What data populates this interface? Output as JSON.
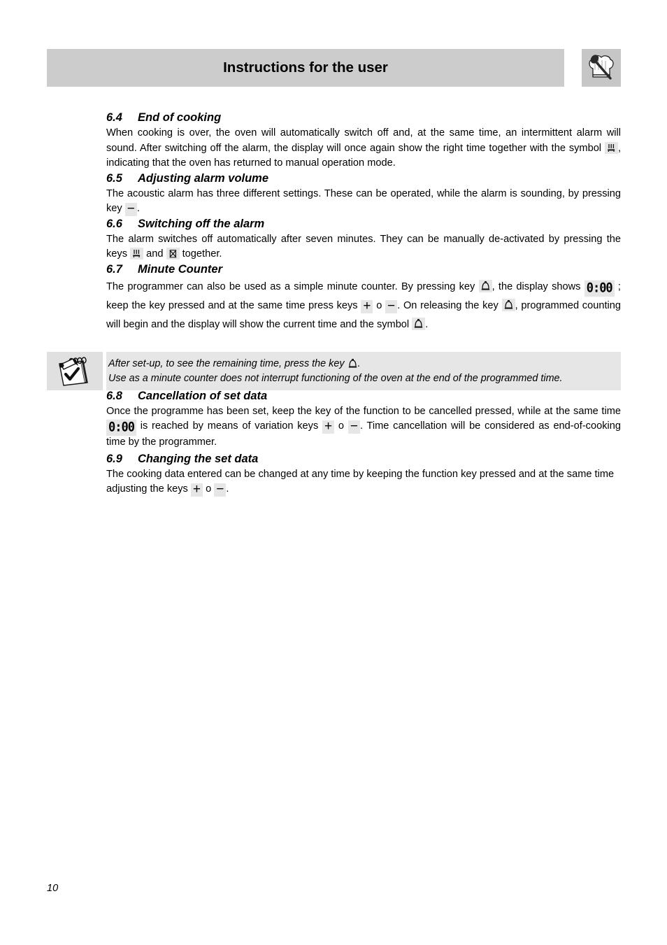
{
  "header": {
    "title": "Instructions for the user",
    "icon": "chef-hat-spoon-icon",
    "bar_color": "#cccccc",
    "icon_box_color": "#c6c6c6"
  },
  "sections": [
    {
      "number": "6.4",
      "title": "End of cooking",
      "text_1": "When cooking is over, the oven will automatically switch off and, at the same time, an intermittent alarm will sound. After switching off the alarm, the display will once again show the right time together with the symbol",
      "text_2": ", indicating that the oven has returned to manual operation mode."
    },
    {
      "number": "6.5",
      "title": "Adjusting alarm volume",
      "text_1": "The acoustic alarm has three different settings. These can be operated, while the alarm is sounding, by pressing key",
      "text_2": "."
    },
    {
      "number": "6.6",
      "title": "Switching off the alarm",
      "text_1": "The alarm switches off automatically after seven minutes. They can be manually de-activated by pressing the keys",
      "text_2": "and",
      "text_3": "together."
    },
    {
      "number": "6.7",
      "title": "Minute Counter",
      "text_1": "The programmer can also be used as a simple minute counter. By pressing key",
      "text_2": ", the display shows",
      "text_3": "; keep the key pressed and at the same time press keys",
      "text_4": "o",
      "text_5": ". On releasing the key",
      "text_6": ", programmed counting will begin and the display will show the current time and the symbol",
      "text_7": "."
    },
    {
      "number": "6.8",
      "title": "Cancellation of set data",
      "text_1": "Once the programme has been set, keep the key of the function to be cancelled pressed, while at the same time",
      "text_2": "is reached by means of variation keys",
      "text_3": "o",
      "text_4": ". Time cancellation will be considered as end-of-cooking time by the programmer."
    },
    {
      "number": "6.9",
      "title": "Changing the set data",
      "text_1": "The cooking data entered can be changed at any time by keeping the function key pressed and at the same time adjusting the keys",
      "text_2": "o",
      "text_3": "."
    }
  ],
  "note": {
    "icon": "notepad-pencil-check-icon",
    "line_1_a": "After set-up, to see the remaining time, press the key",
    "line_1_b": ".",
    "line_2": "Use as a minute counter does not interrupt functioning of the oven at the end of the programmed time.",
    "background": "#e6e6e6"
  },
  "symbols": {
    "manual_mode": "manual-heat-icon",
    "cancel_cooking": "cancel-cooking-icon",
    "bell": "bell-icon",
    "display_zero": "0:00",
    "plus": "+",
    "minus": "−"
  },
  "footer": {
    "page_number": "10"
  }
}
